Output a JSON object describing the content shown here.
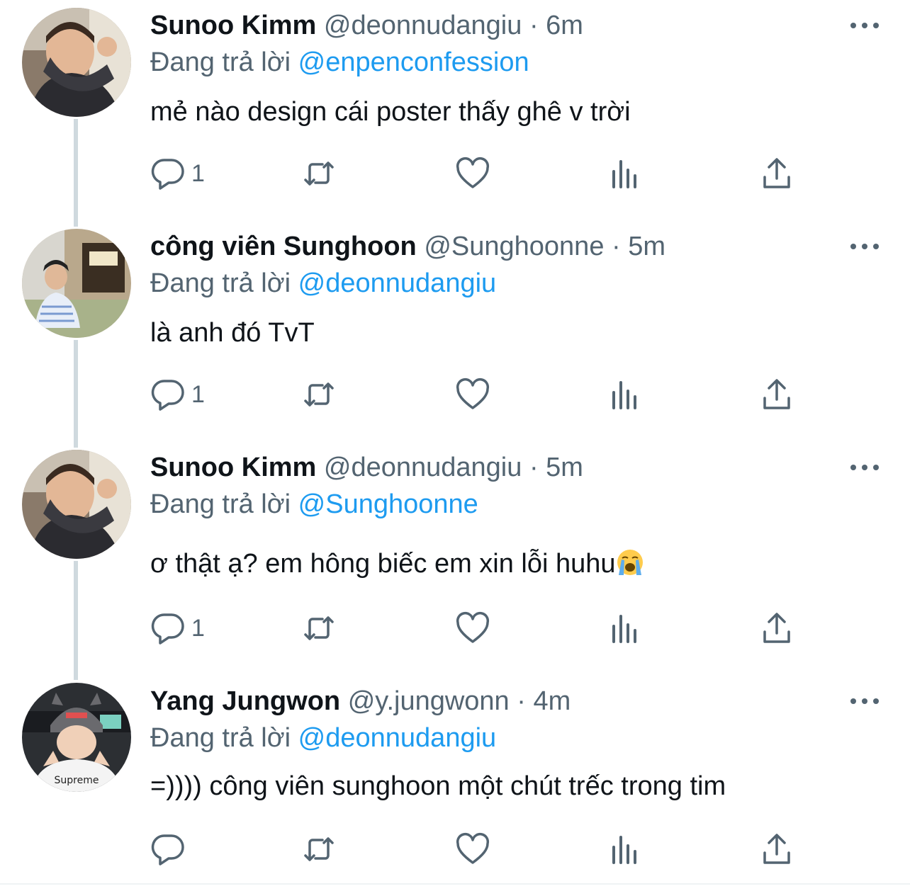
{
  "tweets": [
    {
      "display_name": "Sunoo Kimm",
      "handle": "@deonnudangiu",
      "separator": "·",
      "time": "6m",
      "reply_prefix": "Đang trả lời",
      "reply_to": "@enpenconfession",
      "text": "mẻ nào design cái poster thấy ghê v trời",
      "reply_count": "1"
    },
    {
      "display_name": "công viên Sunghoon",
      "handle": "@Sunghoonne",
      "separator": "·",
      "time": "5m",
      "reply_prefix": "Đang trả lời",
      "reply_to": "@deonnudangiu",
      "text": "là anh đó TvT",
      "reply_count": "1"
    },
    {
      "display_name": "Sunoo Kimm",
      "handle": "@deonnudangiu",
      "separator": "·",
      "time": "5m",
      "reply_prefix": "Đang trả lời",
      "reply_to": "@Sunghoonne",
      "text": "ơ thật ạ? em hông biếc em xin lỗi huhu",
      "emoji": "loudly-crying-face-icon",
      "reply_count": "1"
    },
    {
      "display_name": "Yang Jungwon",
      "handle": "@y.jungwonn",
      "separator": "·",
      "time": "4m",
      "reply_prefix": "Đang trả lời",
      "reply_to": "@deonnudangiu",
      "text": "=)))) công viên sunghoon một chút trếc trong tim",
      "reply_count": ""
    }
  ],
  "icons": {
    "reply": "reply-icon",
    "retweet": "retweet-icon",
    "like": "heart-icon",
    "views": "views-icon",
    "share": "share-icon",
    "more": "more-icon"
  },
  "colors": {
    "text": "#0f1419",
    "secondary": "#536471",
    "mention": "#1d9bf0",
    "thread_line": "#cfd9de"
  }
}
